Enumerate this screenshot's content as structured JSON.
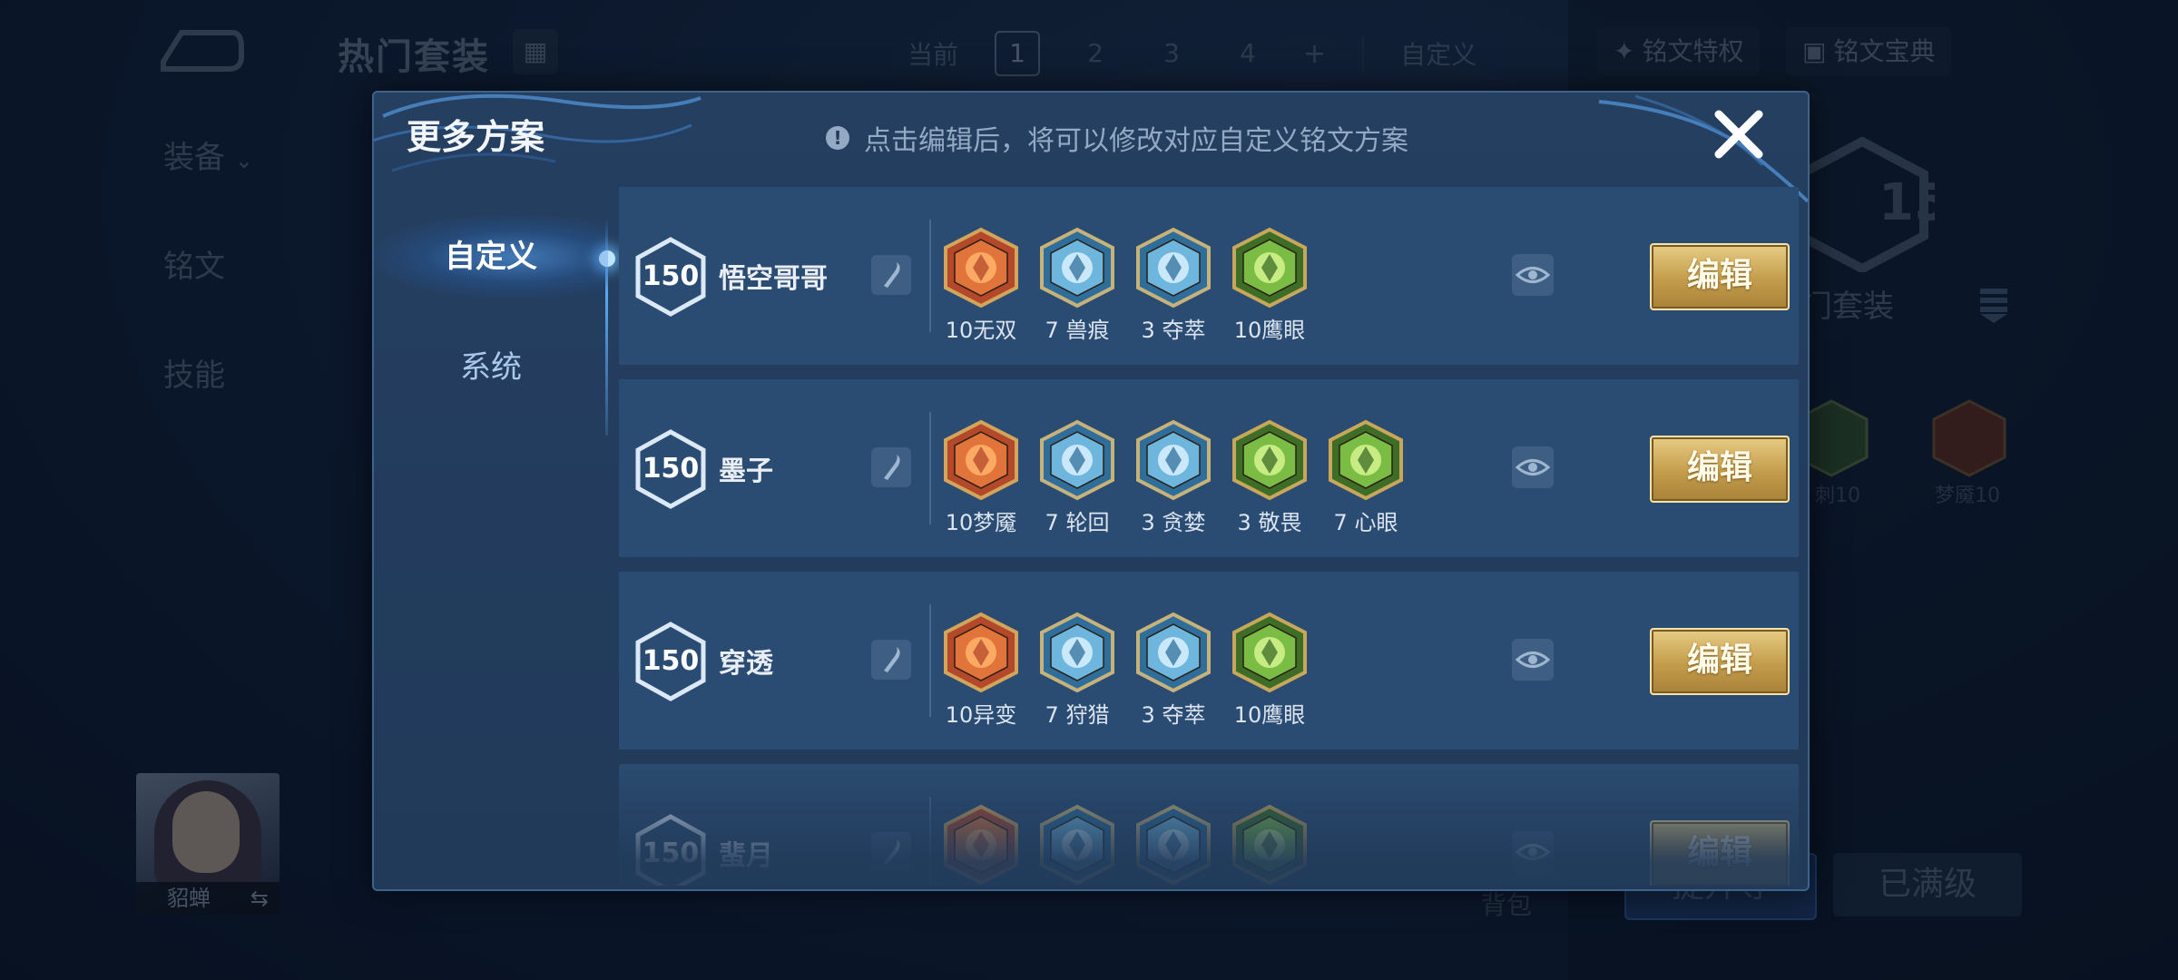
{
  "background": {
    "title": "热门套装",
    "pages": {
      "current_label": "当前",
      "items": [
        "1",
        "2",
        "3",
        "4"
      ],
      "active": "1",
      "plus": "+",
      "custom_label": "自定义"
    },
    "top_buttons": {
      "privilege": "铭文特权",
      "codex": "铭文宝典"
    },
    "side_nav": {
      "equipment": "装备",
      "inscription": "铭文",
      "skills": "技能"
    },
    "level_value": "150",
    "hot_label": "门套装",
    "runes": [
      {
        "label": "刺10"
      },
      {
        "label": "梦魇10"
      }
    ],
    "hero_name": "貂蝉",
    "bag_label": "背包",
    "upgrade_label": "提升等",
    "maxed_label": "已满级"
  },
  "modal": {
    "title": "更多方案",
    "notice": "点击编辑后，将可以修改对应自定义铭文方案",
    "tabs": {
      "custom": "自定义",
      "system": "系统"
    },
    "edit_label": "编辑",
    "plans": [
      {
        "level": "150",
        "name": "悟空哥哥",
        "runes": [
          {
            "label": "10无双",
            "color": "red"
          },
          {
            "label": "7 兽痕",
            "color": "blue"
          },
          {
            "label": "3 夺萃",
            "color": "blue"
          },
          {
            "label": "10鹰眼",
            "color": "green"
          }
        ]
      },
      {
        "level": "150",
        "name": "墨子",
        "runes": [
          {
            "label": "10梦魇",
            "color": "red"
          },
          {
            "label": "7 轮回",
            "color": "blue"
          },
          {
            "label": "3 贪婪",
            "color": "blue"
          },
          {
            "label": "3 敬畏",
            "color": "green"
          },
          {
            "label": "7 心眼",
            "color": "green"
          }
        ]
      },
      {
        "level": "150",
        "name": "穿透",
        "runes": [
          {
            "label": "10异变",
            "color": "red"
          },
          {
            "label": "7 狩猎",
            "color": "blue"
          },
          {
            "label": "3 夺萃",
            "color": "blue"
          },
          {
            "label": "10鹰眼",
            "color": "green"
          }
        ]
      },
      {
        "level": "150",
        "name": "蜚月",
        "runes": [
          {
            "label": "",
            "color": "red"
          },
          {
            "label": "",
            "color": "blue"
          },
          {
            "label": "",
            "color": "blue"
          },
          {
            "label": "",
            "color": "green"
          }
        ]
      }
    ]
  },
  "colors": {
    "gold": "#c39c4b",
    "panel": "#213a5a",
    "row": "#2b4c72",
    "accent_blue": "#5aa9f2"
  }
}
